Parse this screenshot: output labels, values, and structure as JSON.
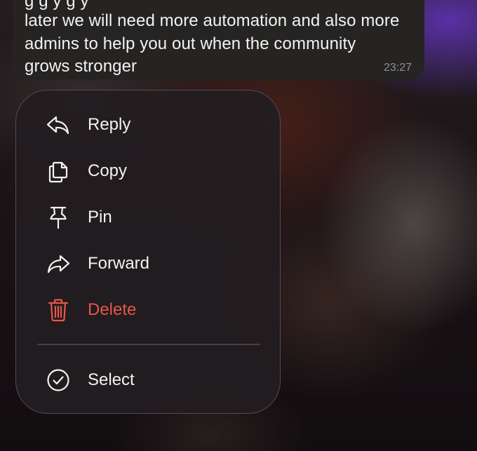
{
  "message": {
    "lines": [
      "g          g y      g                    y",
      "later we will need more automation and also more",
      "admins to help you out when the community",
      "grows stronger"
    ],
    "time": "23:27"
  },
  "context_menu": {
    "items": [
      {
        "label": "Reply",
        "icon": "reply-icon"
      },
      {
        "label": "Copy",
        "icon": "copy-icon"
      },
      {
        "label": "Pin",
        "icon": "pin-icon"
      },
      {
        "label": "Forward",
        "icon": "forward-icon"
      },
      {
        "label": "Delete",
        "icon": "trash-icon"
      }
    ],
    "secondary": [
      {
        "label": "Select",
        "icon": "checkmark-circle-icon"
      }
    ]
  },
  "colors": {
    "menu_text": "#f2f2f2",
    "destructive": "#e8564a",
    "timestamp": "#8e8e90"
  }
}
